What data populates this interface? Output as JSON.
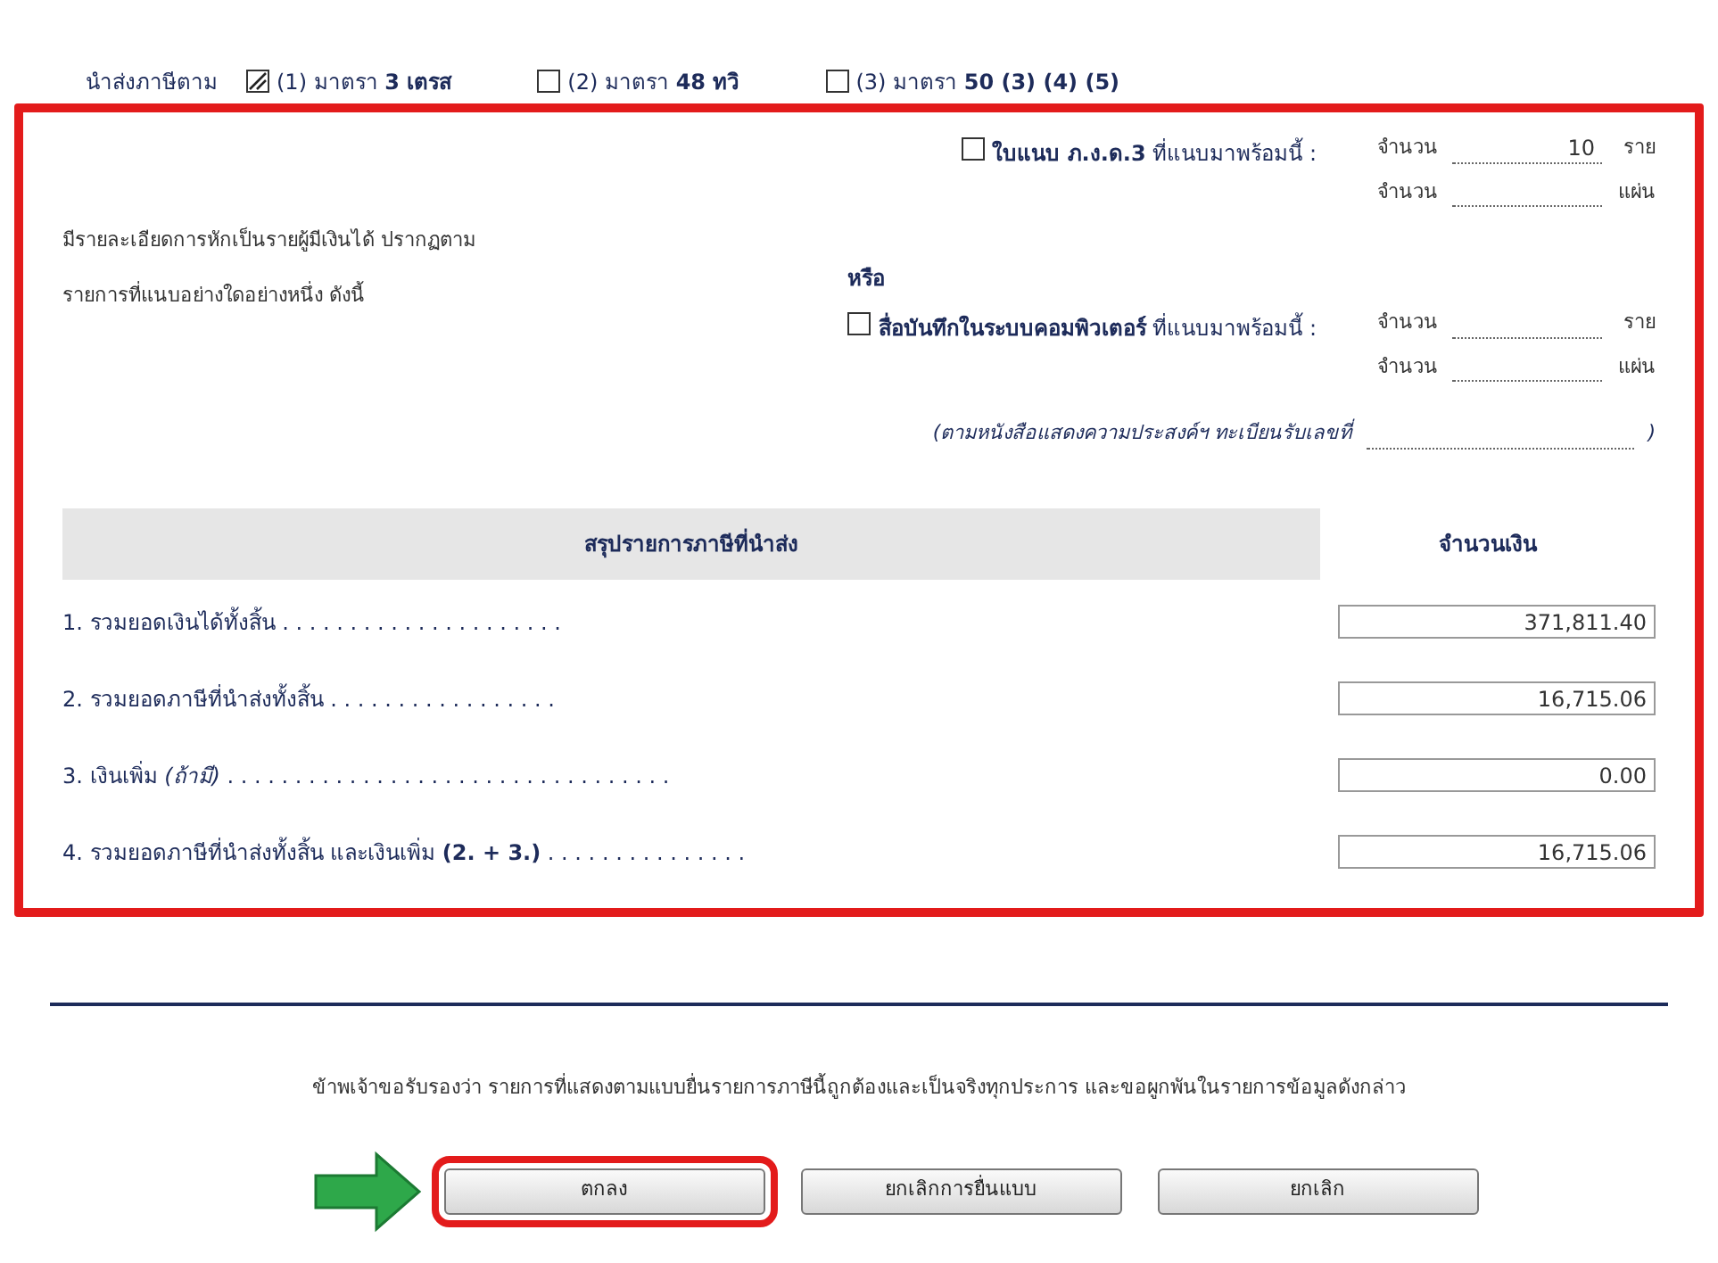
{
  "submit_by": {
    "label": "นำส่งภาษีตาม",
    "options": [
      {
        "text": "(1) มาตรา **3 เตรส**",
        "checked": true
      },
      {
        "text": "(2) มาตรา **48 ทวิ**",
        "checked": false
      },
      {
        "text": "(3) มาตรา **50 (3) (4) (5)**",
        "checked": false
      }
    ]
  },
  "attachment": {
    "highlighted": true,
    "description": [
      "มีรายละเอียดการหักเป็นรายผู้มีเงินได้ ปรากฏตาม",
      "รายการที่แนบอย่างใดอย่างหนึ่ง ดังนี้"
    ],
    "or_label": "หรือ",
    "choices": [
      {
        "text": "**ใบแนบ ภ.ง.ด.3** ที่แนบมาพร้อมนี้ :",
        "checked": false,
        "counts": [
          {
            "label": "จำนวน",
            "value": "10",
            "unit": "ราย"
          },
          {
            "label": "จำนวน",
            "unit": "แผ่น"
          }
        ]
      },
      {
        "text": "**สื่อบันทึกในระบบคอมพิวเตอร์** ที่แนบมาพร้อมนี้ :",
        "checked": false,
        "counts": [
          {
            "label": "จำนวน",
            "unit": "ราย"
          },
          {
            "label": "จำนวน",
            "unit": "แผ่น"
          }
        ]
      }
    ],
    "registration_note": "(ตามหนังสือแสดงความประสงค์ฯ ทะเบียนรับเลขที่",
    "registration_close": ")",
    "summary": {
      "columns": [
        "สรุปรายการภาษีที่นำส่ง",
        "จำนวนเงิน"
      ],
      "rows": [
        {
          "label": "1. รวมยอดเงินได้ทั้งสิ้น . . . . . . . . . . . . . . . . . . . . .",
          "amount": "371,811.40"
        },
        {
          "label": "2. รวมยอดภาษีที่นำส่งทั้งสิ้น . . . . . . . . . . . . . . . . .",
          "amount": "16,715.06"
        },
        {
          "label": "3. เงินเพิ่ม *(ถ้ามี)* . . . . . . . . . . . . . . . . . . . . . . . . . . . . . . . . .",
          "amount": "0.00"
        },
        {
          "label": "4. รวมยอดภาษีที่นำส่งทั้งสิ้น และเงินเพิ่ม **(2. + 3.)** . . . . . . . . . . . . . . .",
          "amount": "16,715.06"
        }
      ]
    }
  },
  "certification": "ข้าพเจ้าขอรับรองว่า รายการที่แสดงตามแบบยื่นรายการภาษีนี้ถูกต้องและเป็นจริงทุกประการ และขอผูกพันในรายการข้อมูลดังกล่าว",
  "buttons": [
    {
      "label": "ตกลง",
      "highlighted": true
    },
    {
      "label": "ยกเลิกการยื่นแบบ",
      "highlighted": false
    },
    {
      "label": "ยกเลิก",
      "highlighted": false
    }
  ]
}
